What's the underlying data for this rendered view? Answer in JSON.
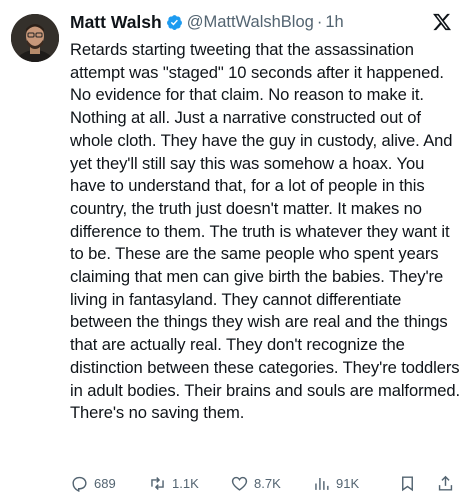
{
  "tweet": {
    "author_name": "Matt Walsh",
    "handle": "@MattWalshBlog",
    "separator": "·",
    "time": "1h",
    "text": "Retards starting tweeting that the assassination attempt was \"staged\" 10 seconds after it happened. No evidence for that claim. No reason to make it. Nothing at all. Just a narrative constructed out of whole cloth. They have the guy in custody, alive. And yet they'll still say this was somehow a hoax. You have to understand that, for a lot of people in this country, the truth just doesn't matter. It makes no difference to them. The truth is whatever they want it to be. These are the same people who spent years claiming that men can give birth the babies. They're living in fantasyland. They cannot differentiate between the things they wish are real and the things that are actually real. They don't recognize the distinction between these categories. They're toddlers in adult bodies. Their brains and souls are malformed. There's no saving them."
  },
  "actions": {
    "replies": "689",
    "reposts": "1.1K",
    "likes": "8.7K",
    "views": "91K"
  },
  "icons": {
    "verified": "verified-badge-icon",
    "platform": "x-logo-icon",
    "reply": "reply-icon",
    "repost": "repost-icon",
    "like": "heart-icon",
    "views": "views-icon",
    "bookmark": "bookmark-icon",
    "share": "share-icon"
  },
  "colors": {
    "text": "#0f1419",
    "secondary": "#536471",
    "verified": "#1d9bf0"
  }
}
